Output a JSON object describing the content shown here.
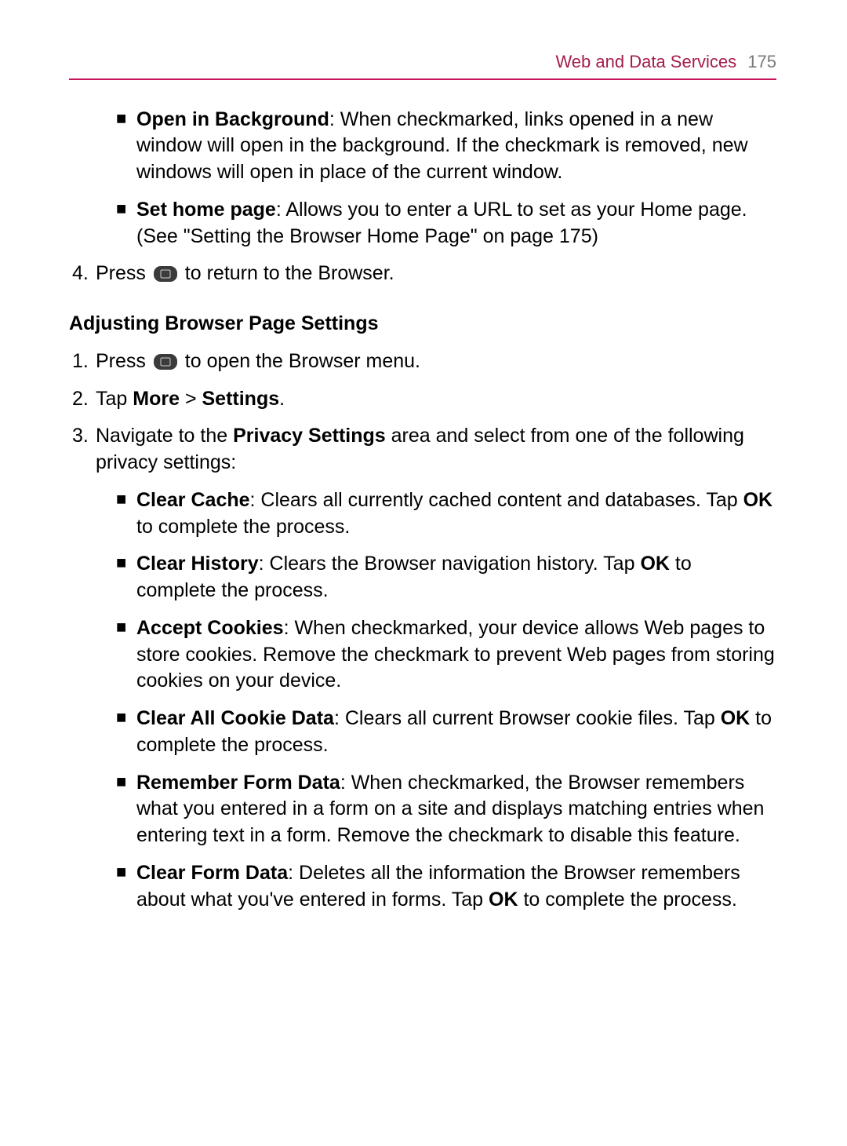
{
  "header": {
    "section_title": "Web and Data Services",
    "page_number": "175"
  },
  "bullets_top": [
    {
      "label": "Open in Background",
      "text": ": When checkmarked, links opened in a new window will open in the background. If the checkmark is removed, new windows will open in place of the current window."
    },
    {
      "label": "Set home page",
      "text": ": Allows you to enter a URL to set as your Home page. (See \"Setting the Browser Home Page\" on page 175)"
    }
  ],
  "step4": {
    "num": "4.",
    "pre": "Press ",
    "post": " to return to the Browser."
  },
  "heading2": "Adjusting Browser Page Settings",
  "step1": {
    "num": "1.",
    "pre": "Press ",
    "post": " to open the Browser menu."
  },
  "step2": {
    "num": "2.",
    "pre": "Tap ",
    "bold1": "More",
    "mid": " > ",
    "bold2": "Settings",
    "post": "."
  },
  "step3": {
    "num": "3.",
    "pre": "Navigate to the ",
    "bold": "Privacy Settings",
    "post": " area and select from one of the following privacy settings:"
  },
  "privacy_bullets": [
    {
      "label": "Clear Cache",
      "t1": ": Clears all currently cached content and databases. Tap ",
      "b1": "OK",
      "t2": " to complete the process."
    },
    {
      "label": "Clear History",
      "t1": ": Clears the Browser navigation history. Tap ",
      "b1": "OK",
      "t2": " to complete the process."
    },
    {
      "label": "Accept Cookies",
      "t1": ": When checkmarked, your device allows Web pages to store cookies. Remove the checkmark to prevent Web pages from storing cookies on your device.",
      "b1": "",
      "t2": ""
    },
    {
      "label": "Clear All Cookie Data",
      "t1": ": Clears all current Browser cookie files. Tap ",
      "b1": "OK",
      "t2": " to complete the process."
    },
    {
      "label": "Remember Form Data",
      "t1": ": When checkmarked, the Browser remembers what you entered in a form on a site and displays matching entries when entering text in a form. Remove the checkmark to disable this feature.",
      "b1": "",
      "t2": ""
    },
    {
      "label": "Clear Form Data",
      "t1": ": Deletes all the information the Browser remembers about what you've entered in forms. Tap ",
      "b1": "OK",
      "t2": " to complete the process."
    }
  ]
}
